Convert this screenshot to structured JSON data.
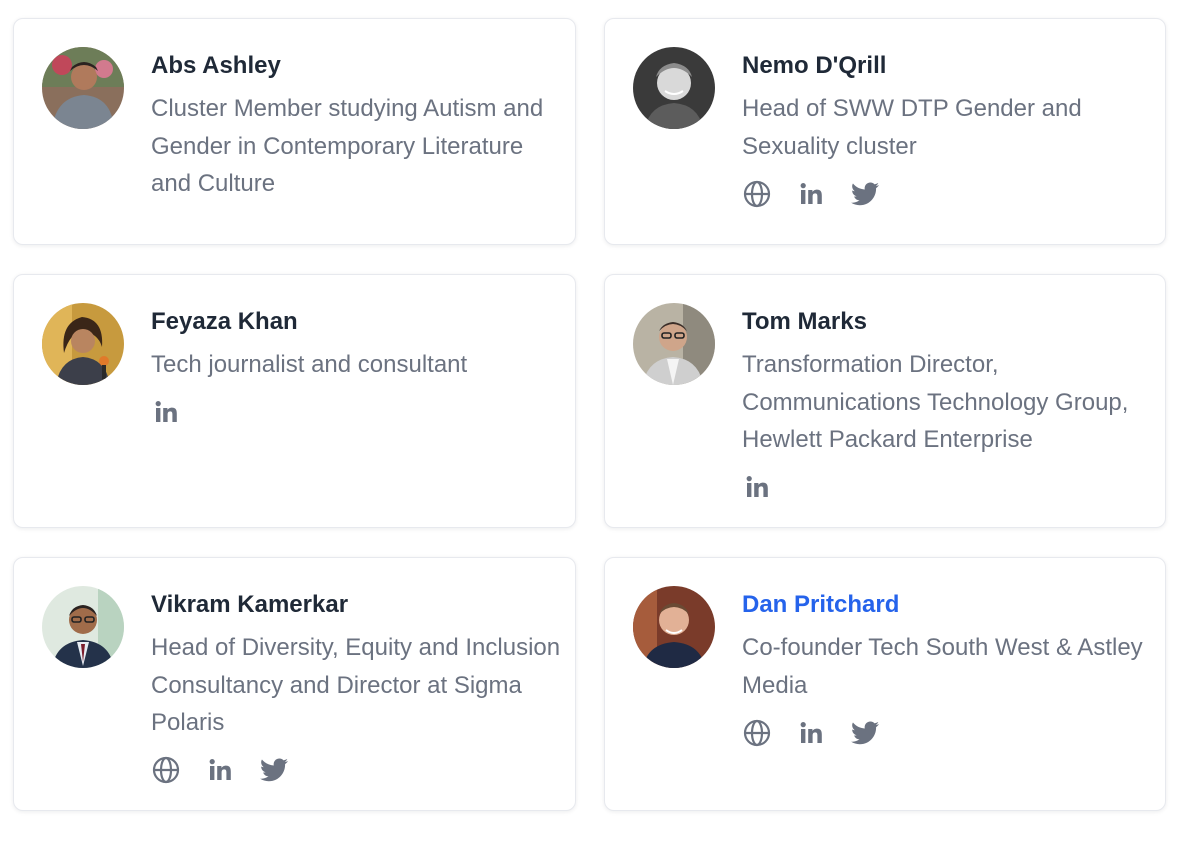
{
  "colors": {
    "name_text": "#1f2937",
    "name_link": "#2563eb",
    "bio_text": "#6b7280",
    "icon": "#6b7280",
    "card_border": "#e7e9ee"
  },
  "cards": [
    {
      "name": "Abs Ashley",
      "bio": "Cluster Member studying Autism and Gender in Contemporary Literature and Culture",
      "socials": [],
      "name_is_link": false
    },
    {
      "name": "Nemo D'Qrill",
      "bio": "Head of SWW DTP Gender and Sexuality cluster",
      "socials": [
        "globe-icon",
        "linkedin-icon",
        "twitter-icon"
      ],
      "name_is_link": false
    },
    {
      "name": "Feyaza Khan",
      "bio": "Tech journalist and consultant",
      "socials": [
        "linkedin-icon"
      ],
      "name_is_link": false
    },
    {
      "name": "Tom Marks",
      "bio": "Transformation Director, Communications Technology Group, Hewlett Packard Enterprise",
      "socials": [
        "linkedin-icon"
      ],
      "name_is_link": false
    },
    {
      "name": "Vikram Kamerkar",
      "bio": "Head of Diversity, Equity and Inclusion Consultancy and Director at Sigma Polaris",
      "socials": [
        "globe-icon",
        "linkedin-icon",
        "twitter-icon"
      ],
      "name_is_link": false
    },
    {
      "name": "Dan Pritchard",
      "bio": "Co-founder Tech South West & Astley Media",
      "socials": [
        "globe-icon",
        "linkedin-icon",
        "twitter-icon"
      ],
      "name_is_link": true
    }
  ]
}
